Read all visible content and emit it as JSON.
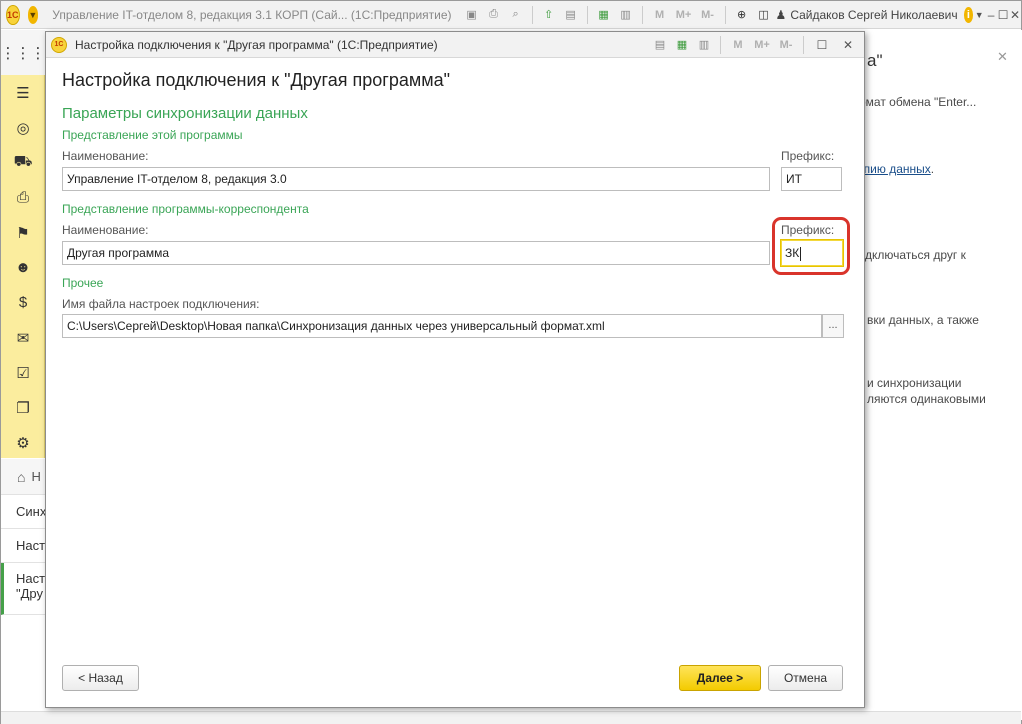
{
  "app": {
    "title": "Управление IT-отделом 8, редакция 3.1 КОРП (Сай...  (1С:Предприятие)",
    "logo_text": "1С",
    "user_name": "Сайдаков Сергей Николаевич",
    "m_buttons": [
      "M",
      "M+",
      "M-"
    ],
    "accent_color": "#f2b600"
  },
  "sidebar": {
    "items": [
      {
        "icon": "grid-icon"
      },
      {
        "icon": "menu-icon"
      },
      {
        "icon": "lifebuoy-icon"
      },
      {
        "icon": "truck-icon"
      },
      {
        "icon": "printer-icon"
      },
      {
        "icon": "checkered-flag-icon"
      },
      {
        "icon": "users-icon"
      },
      {
        "icon": "money-bag-icon"
      },
      {
        "icon": "envelope-icon"
      },
      {
        "icon": "calendar-check-icon"
      },
      {
        "icon": "documents-icon"
      },
      {
        "icon": "settings-icon"
      }
    ]
  },
  "open_windows": {
    "home": "Н",
    "items": [
      "Синх",
      "Наст"
    ],
    "active_line1": "Наст",
    "active_line2": "\"Дру"
  },
  "background_panel": {
    "heading": "а\"",
    "line1": "рмат обмена \"Enter...",
    "link": "опию данных",
    "link_suffix": ".",
    "line2": "дключаться друг к",
    "line3": "вки данных, а также",
    "line4": "и синхронизации",
    "line5": "ляются одинаковыми"
  },
  "dialog": {
    "window_title": "Настройка подключения к \"Другая программа\"  (1С:Предприятие)",
    "heading": "Настройка подключения к \"Другая программа\"",
    "section_title": "Параметры синхронизации данных",
    "this_program": {
      "subtitle": "Представление этой программы",
      "name_label": "Наименование:",
      "name_value": "Управление IT-отделом 8, редакция 3.0",
      "prefix_label": "Префикс:",
      "prefix_value": "ИТ"
    },
    "correspondent": {
      "subtitle": "Представление программы-корреспондента",
      "name_label": "Наименование:",
      "name_value": "Другая программа",
      "prefix_label": "Префикс:",
      "prefix_value": "ЗК"
    },
    "other": {
      "subtitle": "Прочее",
      "file_label": "Имя файла настроек подключения:",
      "file_value": "C:\\Users\\Сергей\\Desktop\\Новая папка\\Синхронизация данных через универсальный формат.xml",
      "select_button": "..."
    },
    "buttons": {
      "back": "< Назад",
      "next": "Далее >",
      "cancel": "Отмена"
    },
    "m_buttons": [
      "M",
      "M+",
      "M-"
    ]
  }
}
